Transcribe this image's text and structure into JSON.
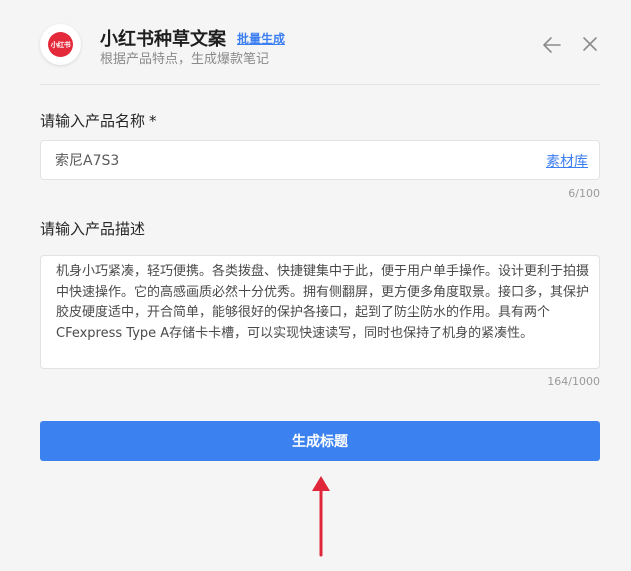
{
  "header": {
    "logo_text": "小红书",
    "title": "小红书种草文案",
    "batch_link": "批量生成",
    "subtitle": "根据产品特点，生成爆款笔记",
    "back_icon": "arrow-left-icon",
    "close_icon": "close-icon"
  },
  "product_name": {
    "label": "请输入产品名称",
    "required_mark": "*",
    "value": "索尼A7S3",
    "material_link": "素材库",
    "counter": "6/100"
  },
  "product_desc": {
    "label": "请输入产品描述",
    "value": "机身小巧紧凑，轻巧便携。各类拨盘、快捷键集中于此，便于用户单手操作。设计更利于拍摄中快速操作。它的高感画质必然十分优秀。拥有侧翻屏，更方便多角度取景。接口多，其保护胶皮硬度适中，开合简单，能够很好的保护各接口，起到了防尘防水的作用。具有两个CFexpress Type A存储卡卡槽，可以实现快速读写，同时也保持了机身的紧凑性。",
    "counter": "164/1000"
  },
  "actions": {
    "generate_label": "生成标题"
  },
  "colors": {
    "accent": "#3b82f0",
    "link": "#3c7ff0",
    "brand_red": "#e4293a",
    "annotation_arrow": "#e0273a"
  }
}
